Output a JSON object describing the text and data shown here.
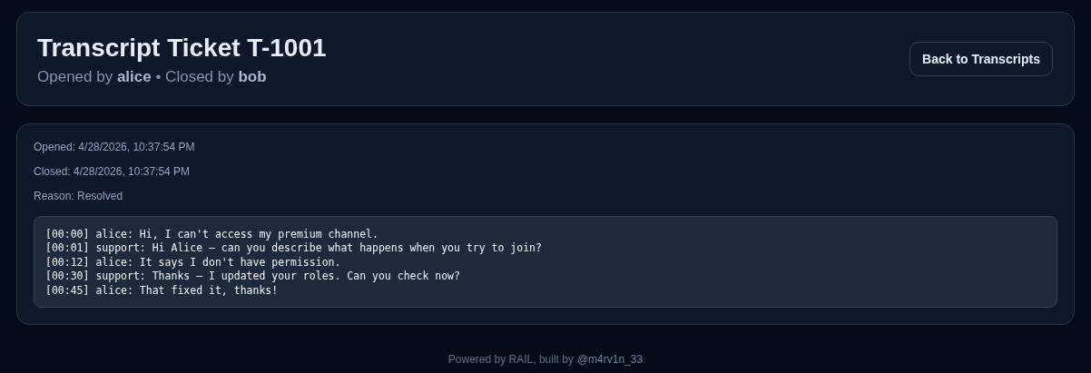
{
  "header": {
    "title": "Transcript Ticket T-1001",
    "subtitle": "Opened by **alice** • Closed by **bob**",
    "back_button": "Back to Transcripts"
  },
  "details": [
    "Opened: 4/28/2026, 10:37:54 PM",
    "Closed: 4/28/2026, 10:37:54 PM",
    "Reason: Resolved"
  ],
  "transcript": [
    "[00:00] alice: Hi, I can't access my premium channel.",
    "[00:01] support: Hi Alice — can you describe what happens when you try to join?",
    "[00:12] alice: It says I don't have permission.",
    "[00:30] support: Thanks — I updated your roles. Can you check now?",
    "[00:45] alice: That fixed it, thanks!"
  ],
  "footer": {
    "text": "Powered by RAIL, built by",
    "link": "@m4rv1n_33"
  }
}
